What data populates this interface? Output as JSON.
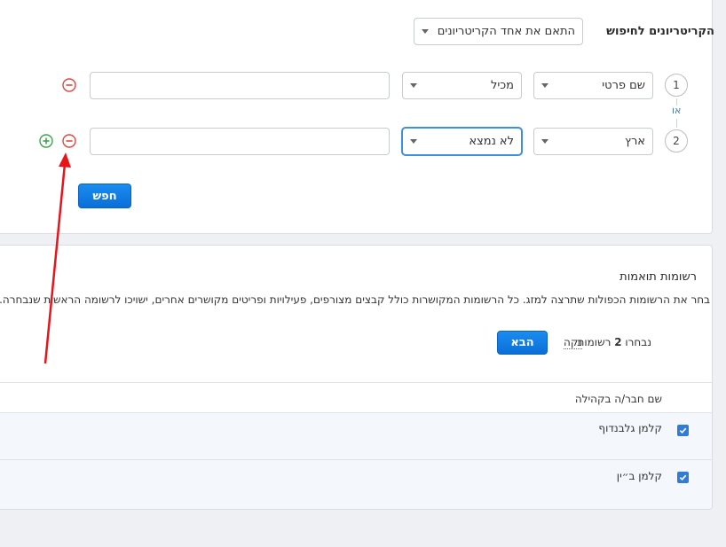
{
  "criteria": {
    "title": "הקריטריונים לחיפוש",
    "match_mode": "התאם את אחד הקריטריונים להלן",
    "or_label": "או",
    "rows": [
      {
        "number": "1",
        "field": "שם פרטי",
        "operator": "מכיל",
        "value": ""
      },
      {
        "number": "2",
        "field": "ארץ",
        "operator": "לא נמצא",
        "value": ""
      }
    ],
    "search_button": "חפש",
    "icons": {
      "remove": "minus-circle-icon",
      "add": "plus-circle-icon"
    },
    "colors": {
      "remove": "#e0463f",
      "add": "#3aa54a",
      "accent": "#0a78e2"
    }
  },
  "results": {
    "title": "רשומות תואמות",
    "description": "בחר את הרשומות הכפולות שתרצה למזג. כל הרשומות המקושרות כולל קבצים מצורפים, פעילויות ופריטים מקושרים אחרים, ישויכו לרשומה הראשית שנבחרה. הרשו",
    "selected_prefix": "נבחרו",
    "selected_count": "2",
    "selected_suffix": "רשומות",
    "clear_link": "נקה",
    "next_button": "הבא",
    "column_header": "שם חבר/ה בקהילה",
    "items": [
      {
        "name": "קלמן גלבנדוף",
        "checked": true
      },
      {
        "name": "קלמן ב״ין",
        "checked": true
      }
    ]
  },
  "annotation": {
    "arrow_color": "#e8141a"
  }
}
